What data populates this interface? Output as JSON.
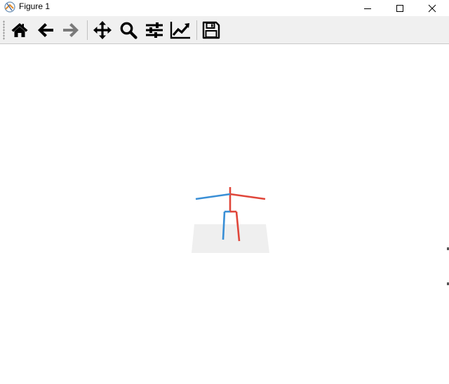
{
  "window": {
    "title": "Figure 1",
    "minimize_icon": "minimize-icon",
    "maximize_icon": "maximize-icon",
    "close_icon": "close-icon"
  },
  "toolbar": {
    "buttons": [
      {
        "name": "home",
        "icon": "home-icon",
        "enabled": true
      },
      {
        "name": "back",
        "icon": "arrow-left-icon",
        "enabled": true
      },
      {
        "name": "forward",
        "icon": "arrow-right-icon",
        "enabled": false
      },
      {
        "name": "pan",
        "icon": "move-icon",
        "enabled": true
      },
      {
        "name": "zoom",
        "icon": "zoom-icon",
        "enabled": true
      },
      {
        "name": "configure-subplots",
        "icon": "sliders-icon",
        "enabled": true
      },
      {
        "name": "edit-axis",
        "icon": "line-chart-icon",
        "enabled": true
      },
      {
        "name": "save",
        "icon": "floppy-disk-icon",
        "enabled": true
      }
    ]
  },
  "figure": {
    "description_colors": {
      "left_side": "#3a8fd6",
      "right_side": "#e0463a",
      "ground_plane": "#efefef"
    }
  }
}
